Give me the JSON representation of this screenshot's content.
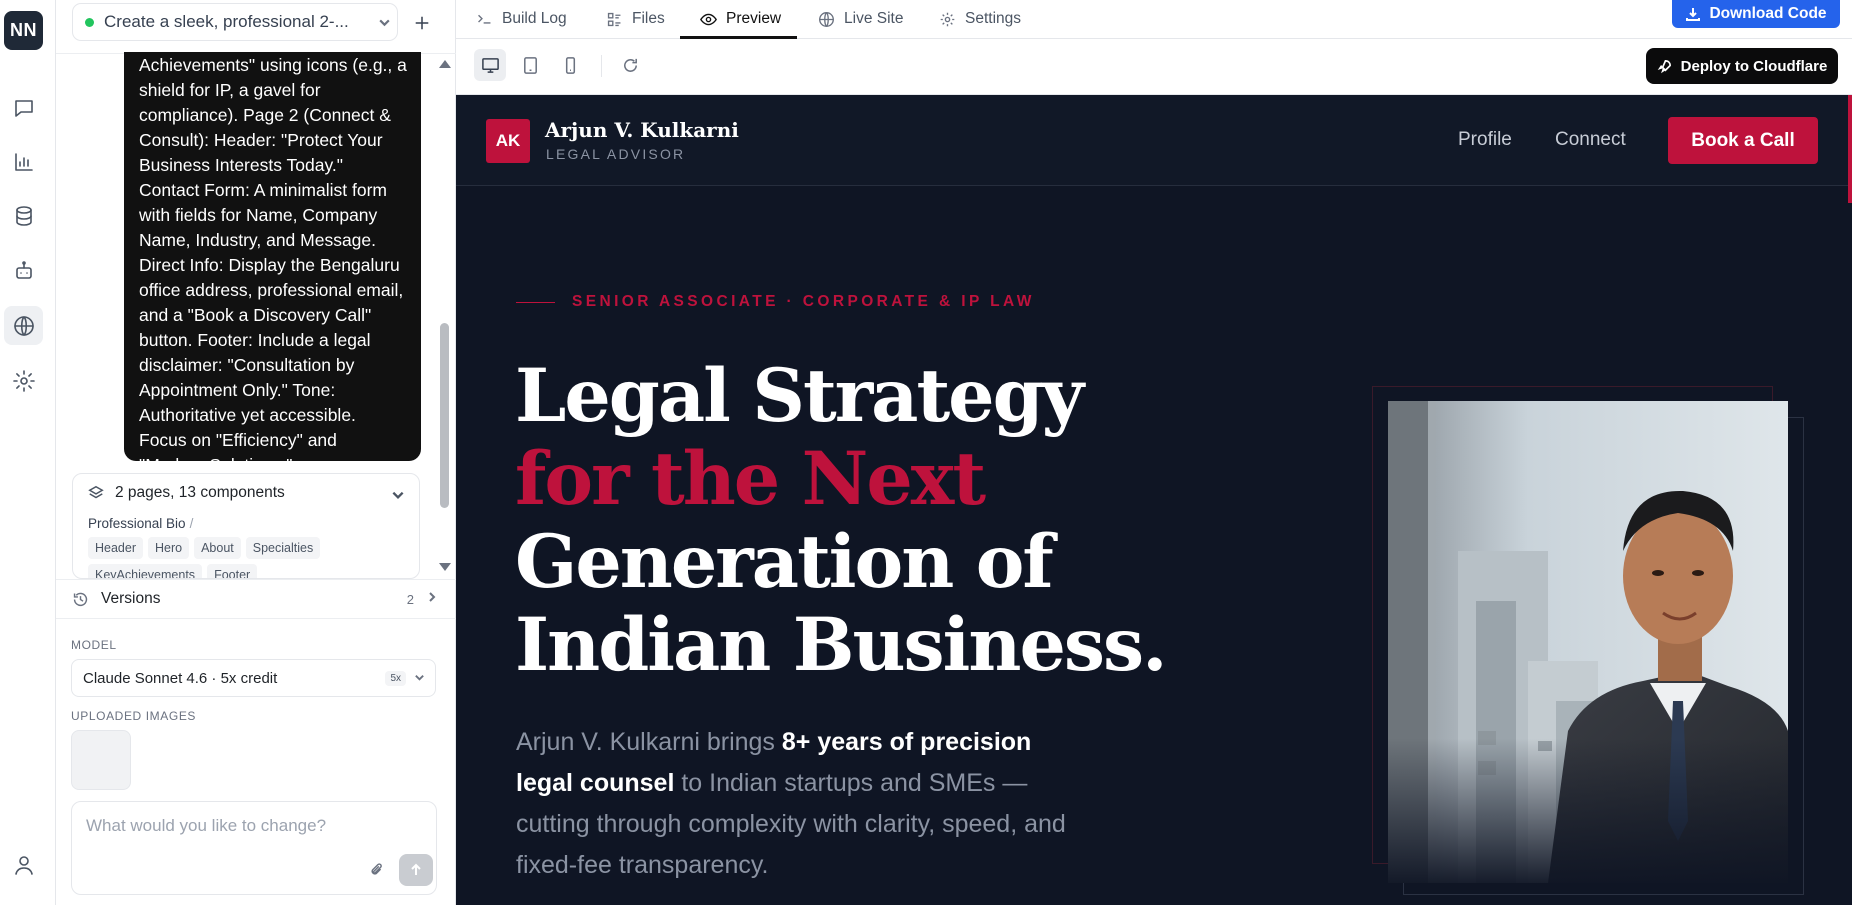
{
  "rail": {
    "logo": "NN",
    "icons": [
      "chat-icon",
      "chart-icon",
      "database-icon",
      "bot-icon",
      "globe-icon",
      "gear-icon",
      "user-icon"
    ]
  },
  "chat": {
    "project_title": "Create a sleek, professional 2-...",
    "message": "Achievements\" using icons (e.g., a shield for IP, a gavel for compliance). Page 2 (Connect & Consult): Header: \"Protect Your Business Interests Today.\" Contact Form: A minimalist form with fields for Name, Company Name, Industry, and Message. Direct Info: Display the Bengaluru office address, professional email, and a \"Book a Discovery Call\" button. Footer: Include a legal disclaimer: \"Consultation by Appointment Only.\" Tone: Authoritative yet accessible. Focus on \"Efficiency\" and \"Modern Solutions.\"",
    "pages_summary": "2 pages, 13 components",
    "page_name": "Professional Bio",
    "page_sep": "/",
    "components": [
      "Header",
      "Hero",
      "About",
      "Specialties",
      "KeyAchievements",
      "Footer"
    ],
    "versions_label": "Versions",
    "versions_count": "2",
    "model_label": "MODEL",
    "model_value": "Claude Sonnet 4.6 · 5x credit",
    "model_badge": "5x",
    "uploads_label": "UPLOADED IMAGES",
    "composer_placeholder": "What would you like to change?"
  },
  "tabs": [
    {
      "label": "Build Log",
      "icon": "terminal-icon"
    },
    {
      "label": "Files",
      "icon": "files-icon"
    },
    {
      "label": "Preview",
      "icon": "eye-icon",
      "active": true
    },
    {
      "label": "Live Site",
      "icon": "globe-icon"
    },
    {
      "label": "Settings",
      "icon": "gear-icon"
    }
  ],
  "download_label": "Download Code",
  "deploy_label": "Deploy to Cloudflare",
  "site": {
    "logo": "AK",
    "name": "Arjun V. Kulkarni",
    "role": "LEGAL ADVISOR",
    "nav": [
      "Profile",
      "Connect"
    ],
    "cta": "Book a Call",
    "eyebrow": "SENIOR ASSOCIATE · CORPORATE & IP LAW",
    "headline": {
      "line1": "Legal Strategy",
      "line2": "for the Next",
      "line3": "Generation of",
      "line4": "Indian Business."
    },
    "lede": {
      "a": "Arjun V. Kulkarni brings ",
      "b": "8+ years of precision legal counsel",
      "c": " to Indian startups and SMEs — cutting through complexity with clarity, speed, and fixed-fee transparency."
    },
    "colors": {
      "accent": "#be123c",
      "bg": "#0f1524"
    }
  }
}
